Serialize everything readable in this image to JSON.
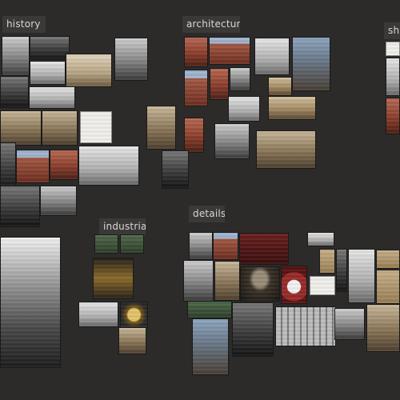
{
  "clusters": {
    "history": {
      "label": "history"
    },
    "architecture": {
      "label": "architecture"
    },
    "partial": {
      "label": "sha"
    },
    "industrial": {
      "label": "industrial"
    },
    "details": {
      "label": "details"
    }
  }
}
